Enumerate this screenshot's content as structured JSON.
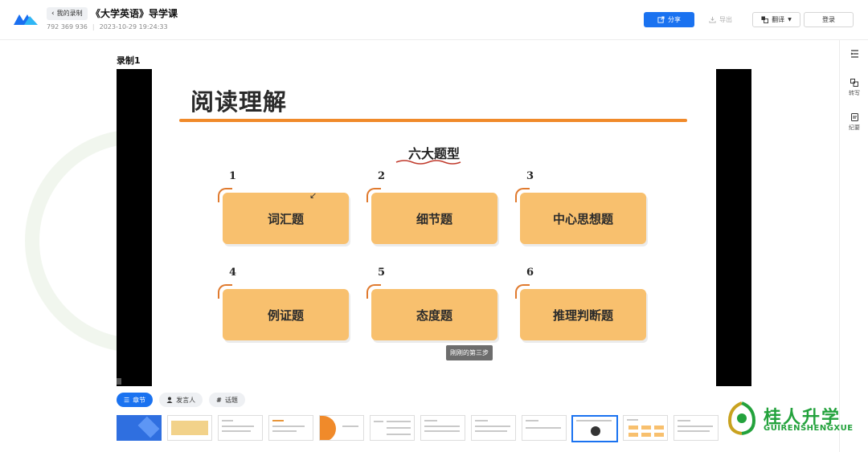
{
  "header": {
    "back_label": "我的录制",
    "title": "《大学英语》导学课",
    "meeting_id": "792 369 936",
    "datetime": "2023-10-29 19:24:33",
    "share_label": "分享",
    "export_label": "导出",
    "translate_label": "翻译",
    "login_label": "登录"
  },
  "rail": {
    "item2_label": "转写",
    "item3_label": "纪要"
  },
  "recording": {
    "title": "录制1"
  },
  "slide": {
    "title": "阅读理解",
    "subtitle": "六大题型",
    "items": [
      {
        "num": "1",
        "label": "词汇题"
      },
      {
        "num": "2",
        "label": "细节题"
      },
      {
        "num": "3",
        "label": "中心思想题"
      },
      {
        "num": "4",
        "label": "例证题"
      },
      {
        "num": "5",
        "label": "态度题"
      },
      {
        "num": "6",
        "label": "推理判断题"
      }
    ],
    "caption": "刚刚的第三步"
  },
  "tabs": [
    {
      "label": "章节",
      "icon": "list-icon",
      "active": true
    },
    {
      "label": "发言人",
      "icon": "person-icon",
      "active": false
    },
    {
      "label": "话题",
      "icon": "hash-icon",
      "active": false
    }
  ],
  "brand": {
    "name": "桂人升学",
    "sub": "GUIRENSHENGXUE"
  },
  "colors": {
    "accent": "#1a72f0",
    "card": "#f8c06e",
    "rule": "#f08a2a",
    "brand": "#23a23c"
  }
}
